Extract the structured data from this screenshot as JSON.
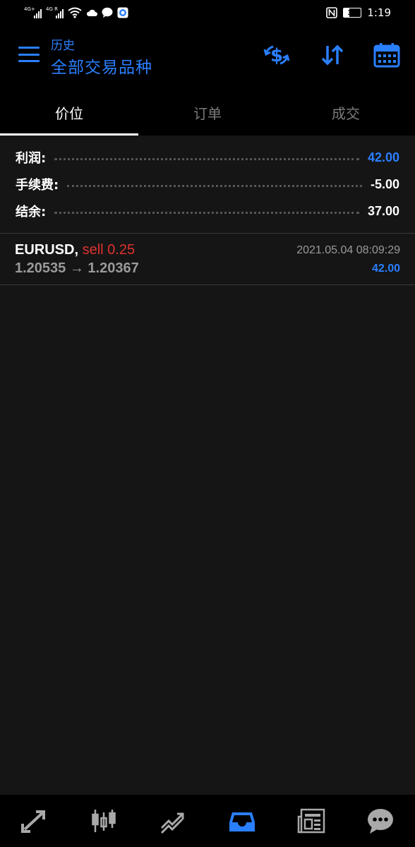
{
  "status_bar": {
    "signal1_tag": "4G+",
    "signal2_tag": "4G R",
    "battery": "34",
    "time": "1:19"
  },
  "header": {
    "subtitle": "历史",
    "title": "全部交易品种"
  },
  "tabs": [
    {
      "label": "价位",
      "active": true
    },
    {
      "label": "订单",
      "active": false
    },
    {
      "label": "成交",
      "active": false
    }
  ],
  "summary": {
    "profit_label": "利润:",
    "profit_value": "42.00",
    "commission_label": "手续费:",
    "commission_value": "-5.00",
    "balance_label": "结余:",
    "balance_value": "37.00"
  },
  "deal": {
    "symbol": "EURUSD,",
    "side": "sell 0.25",
    "prices": "1.20535 → 1.20367",
    "time": "2021.05.04 08:09:29",
    "profit": "42.00"
  },
  "colors": {
    "accent": "#2a7fff",
    "sell": "#e0322f",
    "background": "#151515",
    "bar": "#000000"
  },
  "icons": {
    "header": [
      "menu-icon",
      "currency-exchange-icon",
      "sort-icon",
      "calendar-icon"
    ],
    "bottom_nav": [
      "quotes-icon",
      "chart-icon",
      "trade-icon",
      "history-icon",
      "news-icon",
      "chat-icon"
    ]
  }
}
